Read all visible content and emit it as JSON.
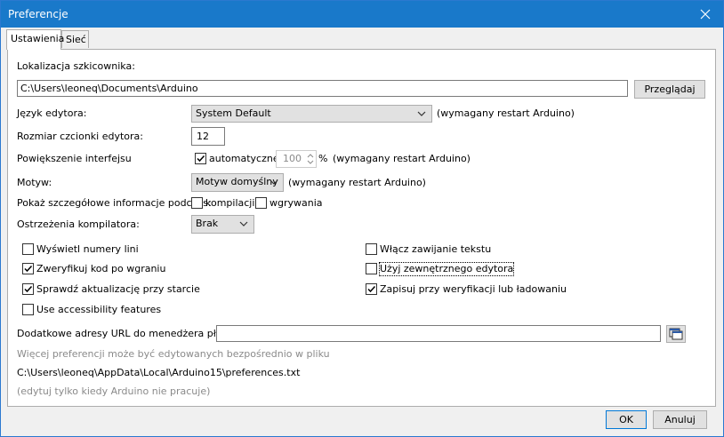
{
  "window": {
    "title": "Preferencje",
    "close_icon": "close-icon"
  },
  "tabs": [
    {
      "label": "Ustawienia",
      "active": true
    },
    {
      "label": "Sieć",
      "active": false
    }
  ],
  "sketchbook": {
    "label": "Lokalizacja szkicownika:",
    "value": "C:\\Users\\leoneq\\Documents\\Arduino",
    "browse_label": "Przeglądaj"
  },
  "language": {
    "label": "Język edytora:",
    "value": "System Default",
    "note": "(wymagany restart Arduino)"
  },
  "font_size": {
    "label": "Rozmiar czcionki edytora:",
    "value": "12"
  },
  "scaling": {
    "label": "Powiększenie interfejsu",
    "auto_label": "automatyczne",
    "auto_checked": true,
    "value": "100",
    "unit": "%",
    "note": "(wymagany restart Arduino)"
  },
  "theme": {
    "label": "Motyw:",
    "value": "Motyw domyślny",
    "note": "(wymagany restart Arduino)"
  },
  "verbose": {
    "label": "Pokaż szczegółowe informacje podczas:",
    "compile_label": "kompilacji",
    "compile_checked": false,
    "upload_label": "wgrywania",
    "upload_checked": false
  },
  "warnings": {
    "label": "Ostrzeżenia kompilatora:",
    "value": "Brak"
  },
  "options_left": [
    {
      "label": "Wyświetl numery lini",
      "checked": false
    },
    {
      "label": "Zweryfikuj kod po wgraniu",
      "checked": true
    },
    {
      "label": "Sprawdź aktualizację przy starcie",
      "checked": true
    },
    {
      "label": "Use accessibility features",
      "checked": false
    }
  ],
  "options_right": [
    {
      "label": "Włącz zawijanie tekstu",
      "checked": false
    },
    {
      "label": "Użyj zewnętrznego edytora",
      "checked": false
    },
    {
      "label": "Zapisuj przy weryfikacji lub ładowaniu",
      "checked": true
    }
  ],
  "board_urls": {
    "label": "Dodatkowe adresy URL do menedżera płytek:",
    "value": "",
    "button_icon": "window-list-icon"
  },
  "info": {
    "edit_note": "Więcej preferencji może być edytowanych bezpośrednio w pliku",
    "path": "C:\\Users\\leoneq\\AppData\\Local\\Arduino15\\preferences.txt",
    "hint": "(edytuj tylko kiedy Arduino nie pracuje)"
  },
  "footer": {
    "ok_label": "OK",
    "cancel_label": "Anuluj"
  },
  "colors": {
    "titlebar": "#1979ca",
    "focus_border": "#0078d7"
  }
}
